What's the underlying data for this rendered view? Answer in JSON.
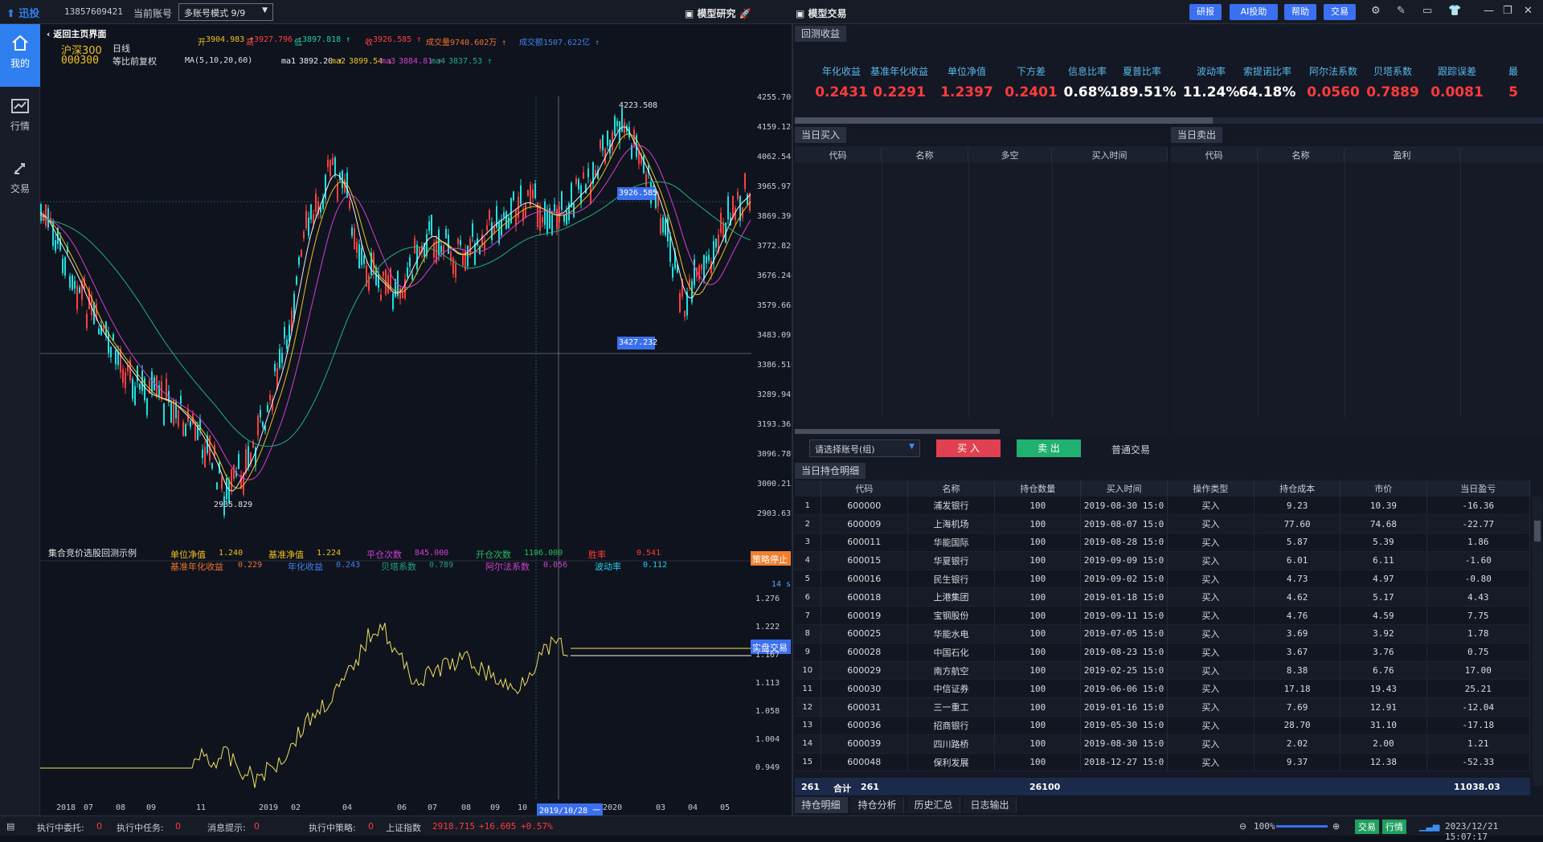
{
  "topbar": {
    "logo": "迅投",
    "phone": "13857609421",
    "account_label": "当前账号",
    "account_mode": "多账号模式 9/9",
    "title_research": "模型研究",
    "title_trade": "模型交易",
    "buttons": [
      "研报",
      "AI投助",
      "帮助",
      "交易"
    ]
  },
  "sidebar": {
    "items": [
      "我的",
      "行情",
      "交易"
    ]
  },
  "chart": {
    "back": "返回主页界面",
    "index_name": "沪深300",
    "period": "日线",
    "code": "000300",
    "adjust": "等比前复权",
    "ma_label": "MA(5,10,20,60)",
    "ohlc": [
      {
        "l": "开",
        "v": "3904.983"
      },
      {
        "l": "高",
        "v": "3927.796"
      },
      {
        "l": "低",
        "v": "3897.818"
      },
      {
        "l": "收",
        "v": "3926.585"
      },
      {
        "l": "成交量",
        "v": "9740.602万"
      },
      {
        "l": "成交额",
        "v": "1507.622亿"
      }
    ],
    "mas": [
      {
        "l": "ma1",
        "v": "3892.20"
      },
      {
        "l": "ma2",
        "v": "3899.54"
      },
      {
        "l": "ma3",
        "v": "3884.81"
      },
      {
        "l": "ma4",
        "v": "3837.53"
      }
    ],
    "yticks": [
      "4255.700",
      "4159.124",
      "4062.548",
      "3965.972",
      "3869.396",
      "3772.820",
      "3676.244",
      "3579.668",
      "3483.092",
      "3386.516",
      "3289.941",
      "3193.365",
      "3096.789",
      "3000.213",
      "2903.637"
    ],
    "price_tag1": "3926.585",
    "price_tag2": "3427.232",
    "high_label": "4223.508",
    "low_label": "2935.829",
    "bt_title": "集合竞价选股回测示例",
    "bt_stats1": [
      {
        "l": "单位净值",
        "v": "1.240"
      },
      {
        "l": "基准净值",
        "v": "1.224"
      },
      {
        "l": "平仓次数",
        "v": "845.000"
      },
      {
        "l": "开仓次数",
        "v": "1106.000"
      },
      {
        "l": "胜率",
        "v": "0.541"
      }
    ],
    "bt_stats2": [
      {
        "l": "基准年化收益",
        "v": "0.229"
      },
      {
        "l": "年化收益",
        "v": "0.243"
      },
      {
        "l": "贝塔系数",
        "v": "0.789"
      },
      {
        "l": "阿尔法系数",
        "v": "0.056"
      },
      {
        "l": "波动率",
        "v": "0.112"
      }
    ],
    "stop_btn": "策略停止",
    "live_btn": "实盘交易",
    "timer": "14 s",
    "yticks2": [
      "1.276",
      "1.222",
      "1.167",
      "1.113",
      "1.058",
      "1.004",
      "0.949"
    ],
    "xticks": [
      "2018",
      "07",
      "08",
      "09",
      "11",
      "2019",
      "02",
      "04",
      "06",
      "07",
      "08",
      "09",
      "10",
      "2019/10/28 一",
      "2020",
      "03",
      "04",
      "05"
    ]
  },
  "right": {
    "tab_backtest": "回测收益",
    "metrics": [
      {
        "l": "年化收益",
        "v": "0.2431",
        "c": "#ff3b3b"
      },
      {
        "l": "基准年化收益",
        "v": "0.2291",
        "c": "#ff3b3b"
      },
      {
        "l": "单位净值",
        "v": "1.2397",
        "c": "#ff3b3b"
      },
      {
        "l": "下方差",
        "v": "0.2401",
        "c": "#ff3b3b"
      },
      {
        "l": "信息比率",
        "v": "0.68%",
        "c": "#ffffff"
      },
      {
        "l": "夏普比率",
        "v": "189.51%",
        "c": "#ffffff"
      },
      {
        "l": "波动率",
        "v": "11.24%",
        "c": "#ffffff"
      },
      {
        "l": "索提诺比率",
        "v": "64.18%",
        "c": "#ffffff"
      },
      {
        "l": "阿尔法系数",
        "v": "0.0560",
        "c": "#ff3b3b"
      },
      {
        "l": "贝塔系数",
        "v": "0.7889",
        "c": "#ff3b3b"
      },
      {
        "l": "跟踪误差",
        "v": "0.0081",
        "c": "#ff3b3b"
      },
      {
        "l": "最",
        "v": "5",
        "c": "#ff3b3b"
      }
    ],
    "tab_buy": "当日买入",
    "tab_sell": "当日卖出",
    "buy_cols": [
      "代码",
      "名称",
      "多空",
      "买入时间"
    ],
    "sell_cols": [
      "代码",
      "名称",
      "盈利"
    ],
    "account_select": "请选择账号(组)",
    "buy_btn": "买 入",
    "sell_btn": "卖 出",
    "normal_trade": "普通交易",
    "tab_positions": "当日持仓明细",
    "pos_cols": [
      "代码",
      "名称",
      "持仓数量",
      "买入时间",
      "操作类型",
      "持仓成本",
      "市价",
      "当日盈亏"
    ],
    "positions": [
      [
        "1",
        "600000",
        "浦发银行",
        "100",
        "2019-08-30 15:0",
        "买入",
        "9.23",
        "10.39",
        "-16.36"
      ],
      [
        "2",
        "600009",
        "上海机场",
        "100",
        "2019-08-07 15:0",
        "买入",
        "77.60",
        "74.68",
        "-22.77"
      ],
      [
        "3",
        "600011",
        "华能国际",
        "100",
        "2019-08-28 15:0",
        "买入",
        "5.87",
        "5.39",
        "1.86"
      ],
      [
        "4",
        "600015",
        "华夏银行",
        "100",
        "2019-09-09 15:0",
        "买入",
        "6.01",
        "6.11",
        "-1.60"
      ],
      [
        "5",
        "600016",
        "民生银行",
        "100",
        "2019-09-02 15:0",
        "买入",
        "4.73",
        "4.97",
        "-0.80"
      ],
      [
        "6",
        "600018",
        "上港集团",
        "100",
        "2019-01-18 15:0",
        "买入",
        "4.62",
        "5.17",
        "4.43"
      ],
      [
        "7",
        "600019",
        "宝钢股份",
        "100",
        "2019-09-11 15:0",
        "买入",
        "4.76",
        "4.59",
        "7.75"
      ],
      [
        "8",
        "600025",
        "华能水电",
        "100",
        "2019-07-05 15:0",
        "买入",
        "3.69",
        "3.92",
        "1.78"
      ],
      [
        "9",
        "600028",
        "中国石化",
        "100",
        "2019-08-23 15:0",
        "买入",
        "3.67",
        "3.76",
        "0.75"
      ],
      [
        "10",
        "600029",
        "南方航空",
        "100",
        "2019-02-25 15:0",
        "买入",
        "8.38",
        "6.76",
        "17.00"
      ],
      [
        "11",
        "600030",
        "中信证券",
        "100",
        "2019-06-06 15:0",
        "买入",
        "17.18",
        "19.43",
        "25.21"
      ],
      [
        "12",
        "600031",
        "三一重工",
        "100",
        "2019-01-16 15:0",
        "买入",
        "7.69",
        "12.91",
        "-12.04"
      ],
      [
        "13",
        "600036",
        "招商银行",
        "100",
        "2019-05-30 15:0",
        "买入",
        "28.70",
        "31.10",
        "-17.18"
      ],
      [
        "14",
        "600039",
        "四川路桥",
        "100",
        "2019-08-30 15:0",
        "买入",
        "2.02",
        "2.00",
        "1.21"
      ],
      [
        "15",
        "600048",
        "保利发展",
        "100",
        "2018-12-27 15:0",
        "买入",
        "9.37",
        "12.38",
        "-52.33"
      ]
    ],
    "total": {
      "count": "261",
      "label": "合计",
      "count2": "261",
      "qty": "26100",
      "pnl": "11038.03"
    },
    "bottom_tabs": [
      "持仓明细",
      "持仓分析",
      "历史汇总",
      "日志输出"
    ]
  },
  "status": {
    "entrust_label": "执行中委托:",
    "entrust": "0",
    "task_label": "执行中任务:",
    "task": "0",
    "msg_label": "消息提示:",
    "msg": "0",
    "strategy_label": "执行中策略:",
    "strategy": "0",
    "index_name": "上证指数",
    "index_val": "2918.715",
    "index_chg": "+16.605",
    "index_pct": "+0.57%",
    "zoom": "100%",
    "trade_btn": "交易",
    "quote_btn": "行情",
    "datetime": "2023/12/21 15:07:17"
  }
}
